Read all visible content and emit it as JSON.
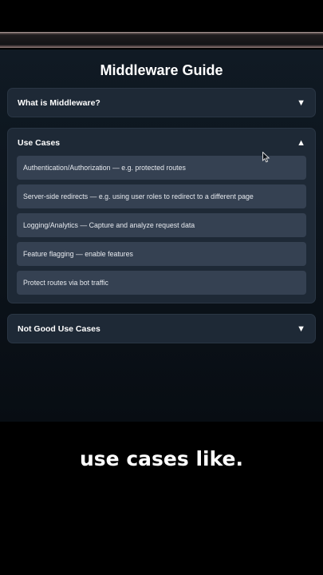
{
  "page": {
    "title": "Middleware Guide"
  },
  "sections": [
    {
      "title": "What is Middleware?",
      "arrow": "▼",
      "expanded": false
    },
    {
      "title": "Use Cases",
      "arrow": "▲",
      "expanded": true,
      "items": [
        "Authentication/Authorization — e.g. protected routes",
        "Server-side redirects — e.g. using user roles to redirect to a different page",
        "Logging/Analytics — Capture and analyze request data",
        "Feature flagging — enable features",
        "Protect routes via bot traffic"
      ]
    },
    {
      "title": "Not Good Use Cases",
      "arrow": "▼",
      "expanded": false
    }
  ],
  "caption": "use cases like.",
  "colors": {
    "panel_bg": "#1e2936",
    "item_bg": "#354152",
    "screen_bg": "#0b131c"
  }
}
